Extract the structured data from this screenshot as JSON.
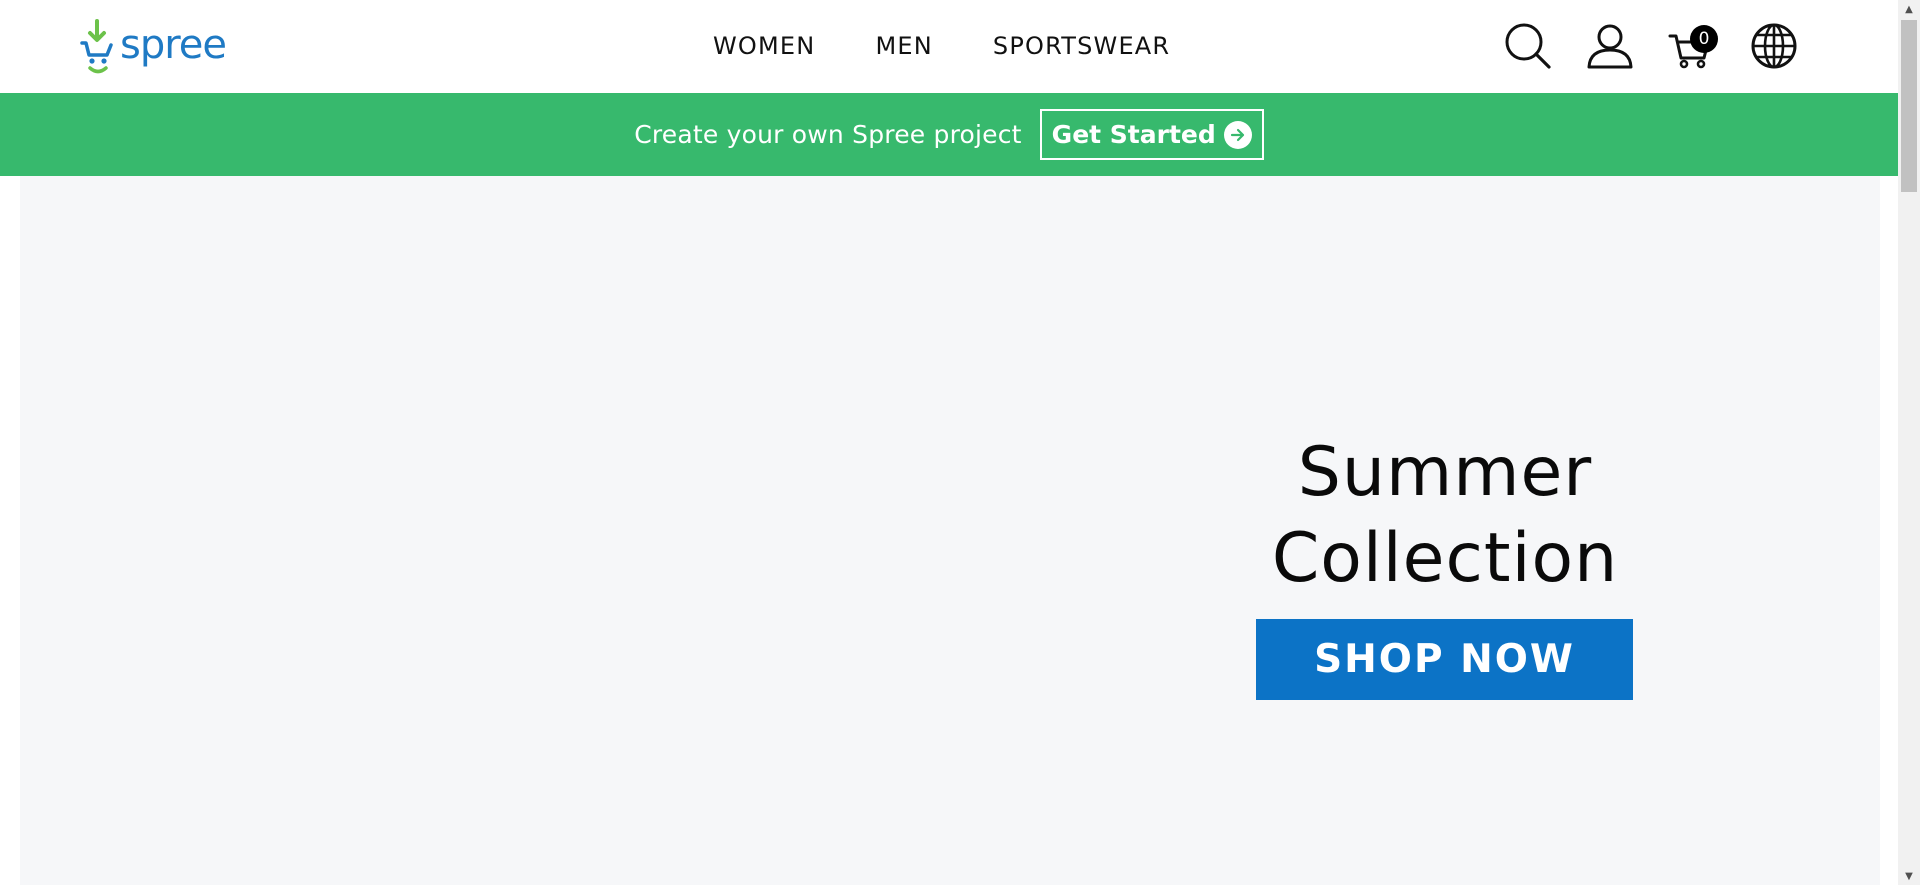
{
  "header": {
    "logo_text": "spree",
    "nav": [
      "WOMEN",
      "MEN",
      "SPORTSWEAR"
    ],
    "icons": [
      "search-icon",
      "user-icon",
      "cart-icon",
      "globe-icon"
    ],
    "cart_count": "0"
  },
  "promo": {
    "text": "Create your own Spree project",
    "button_label": "Get Started",
    "background": "#37b96d"
  },
  "hero": {
    "title_line1": "Summer",
    "title_line2": "Collection",
    "button_label": "SHOP NOW",
    "button_color": "#0c73c6",
    "background": "#f6f7f9"
  }
}
